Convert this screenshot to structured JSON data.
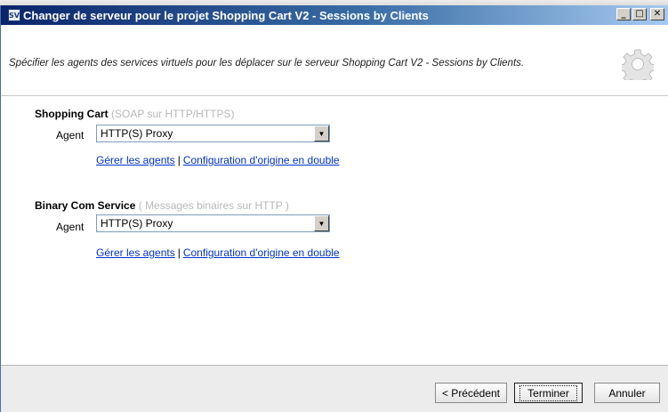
{
  "window": {
    "title": "Changer de serveur pour le projet Shopping Cart V2 - Sessions by Clients",
    "app_icon_text": "SV",
    "buttons": {
      "minimize": "_",
      "maximize": "□",
      "close": "✕"
    }
  },
  "header": {
    "description": "Spécifier les agents des services virtuels pour les déplacer sur le serveur Shopping Cart V2 - Sessions by Clients.",
    "icon": "gear-icon"
  },
  "sections": [
    {
      "name": "Shopping Cart",
      "subtitle": "(SOAP sur HTTP/HTTPS)",
      "agent_label": "Agent",
      "agent_value": "HTTP(S) Proxy",
      "link_manage": "Gérer les agents",
      "link_separator": "|",
      "link_duplicate": "Configuration d'origine en double"
    },
    {
      "name": "Binary Com Service",
      "subtitle": "( Messages binaires sur HTTP )",
      "agent_label": "Agent",
      "agent_value": "HTTP(S) Proxy",
      "link_manage": "Gérer les agents",
      "link_separator": "|",
      "link_duplicate": "Configuration d'origine en double"
    }
  ],
  "footer": {
    "back_label": "< Précédent",
    "finish_label": "Terminer",
    "cancel_label": "Annuler"
  },
  "colors": {
    "title_bar_start": "#0a246a",
    "title_bar_end": "#a6caf0",
    "link": "#0033cc",
    "subtitle_gray": "#b8b8b8"
  }
}
